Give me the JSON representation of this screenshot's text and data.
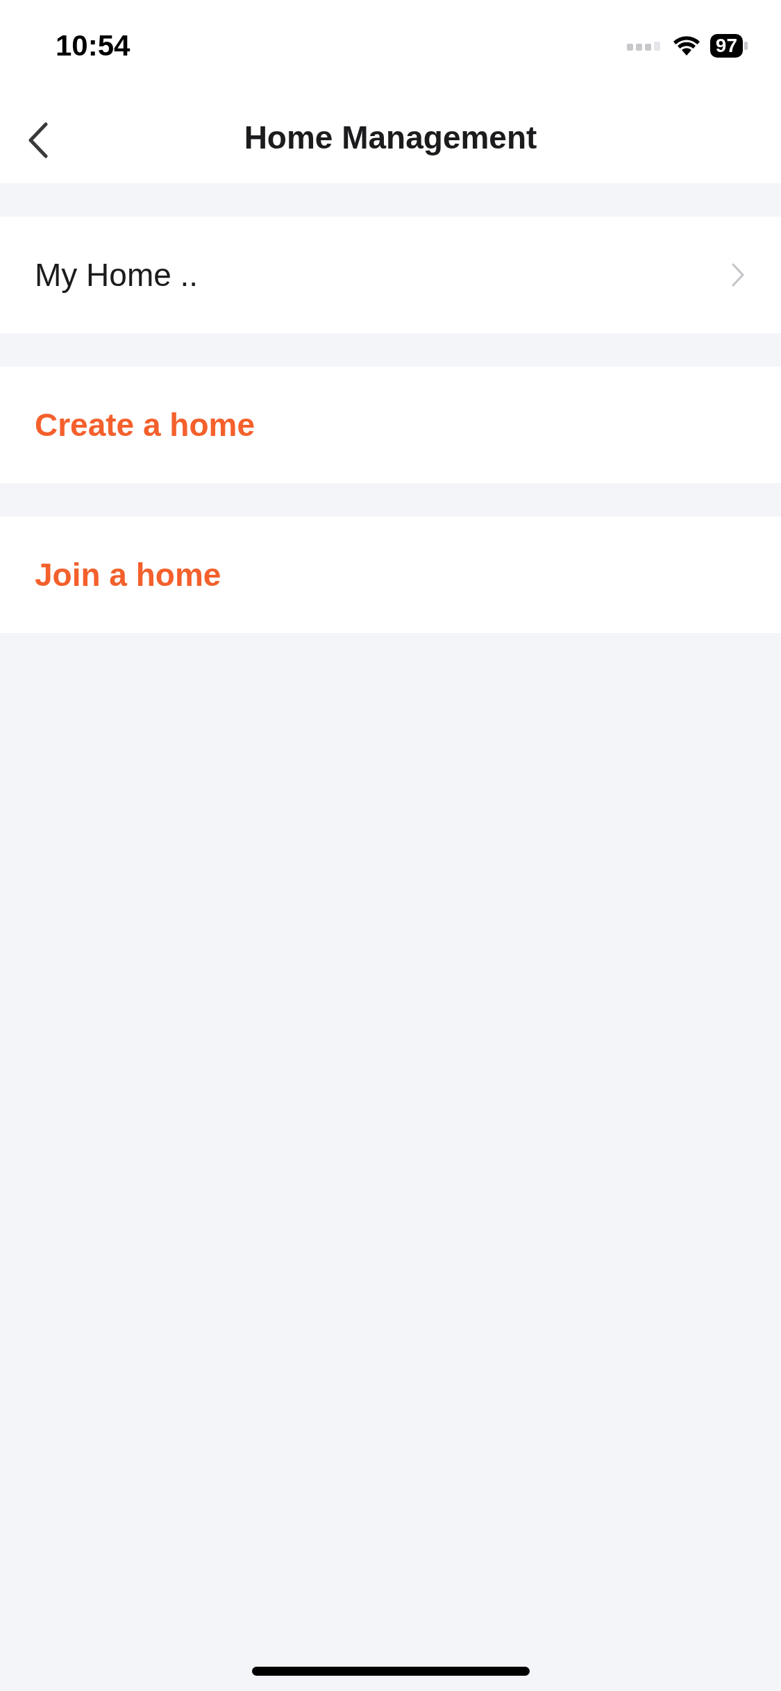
{
  "status_bar": {
    "time": "10:54",
    "battery": "97"
  },
  "nav_bar": {
    "title": "Home Management"
  },
  "sections": [
    {
      "kind": "nav",
      "label": "My Home .."
    },
    {
      "kind": "action",
      "label": "Create a home"
    },
    {
      "kind": "action",
      "label": "Join a home"
    }
  ]
}
